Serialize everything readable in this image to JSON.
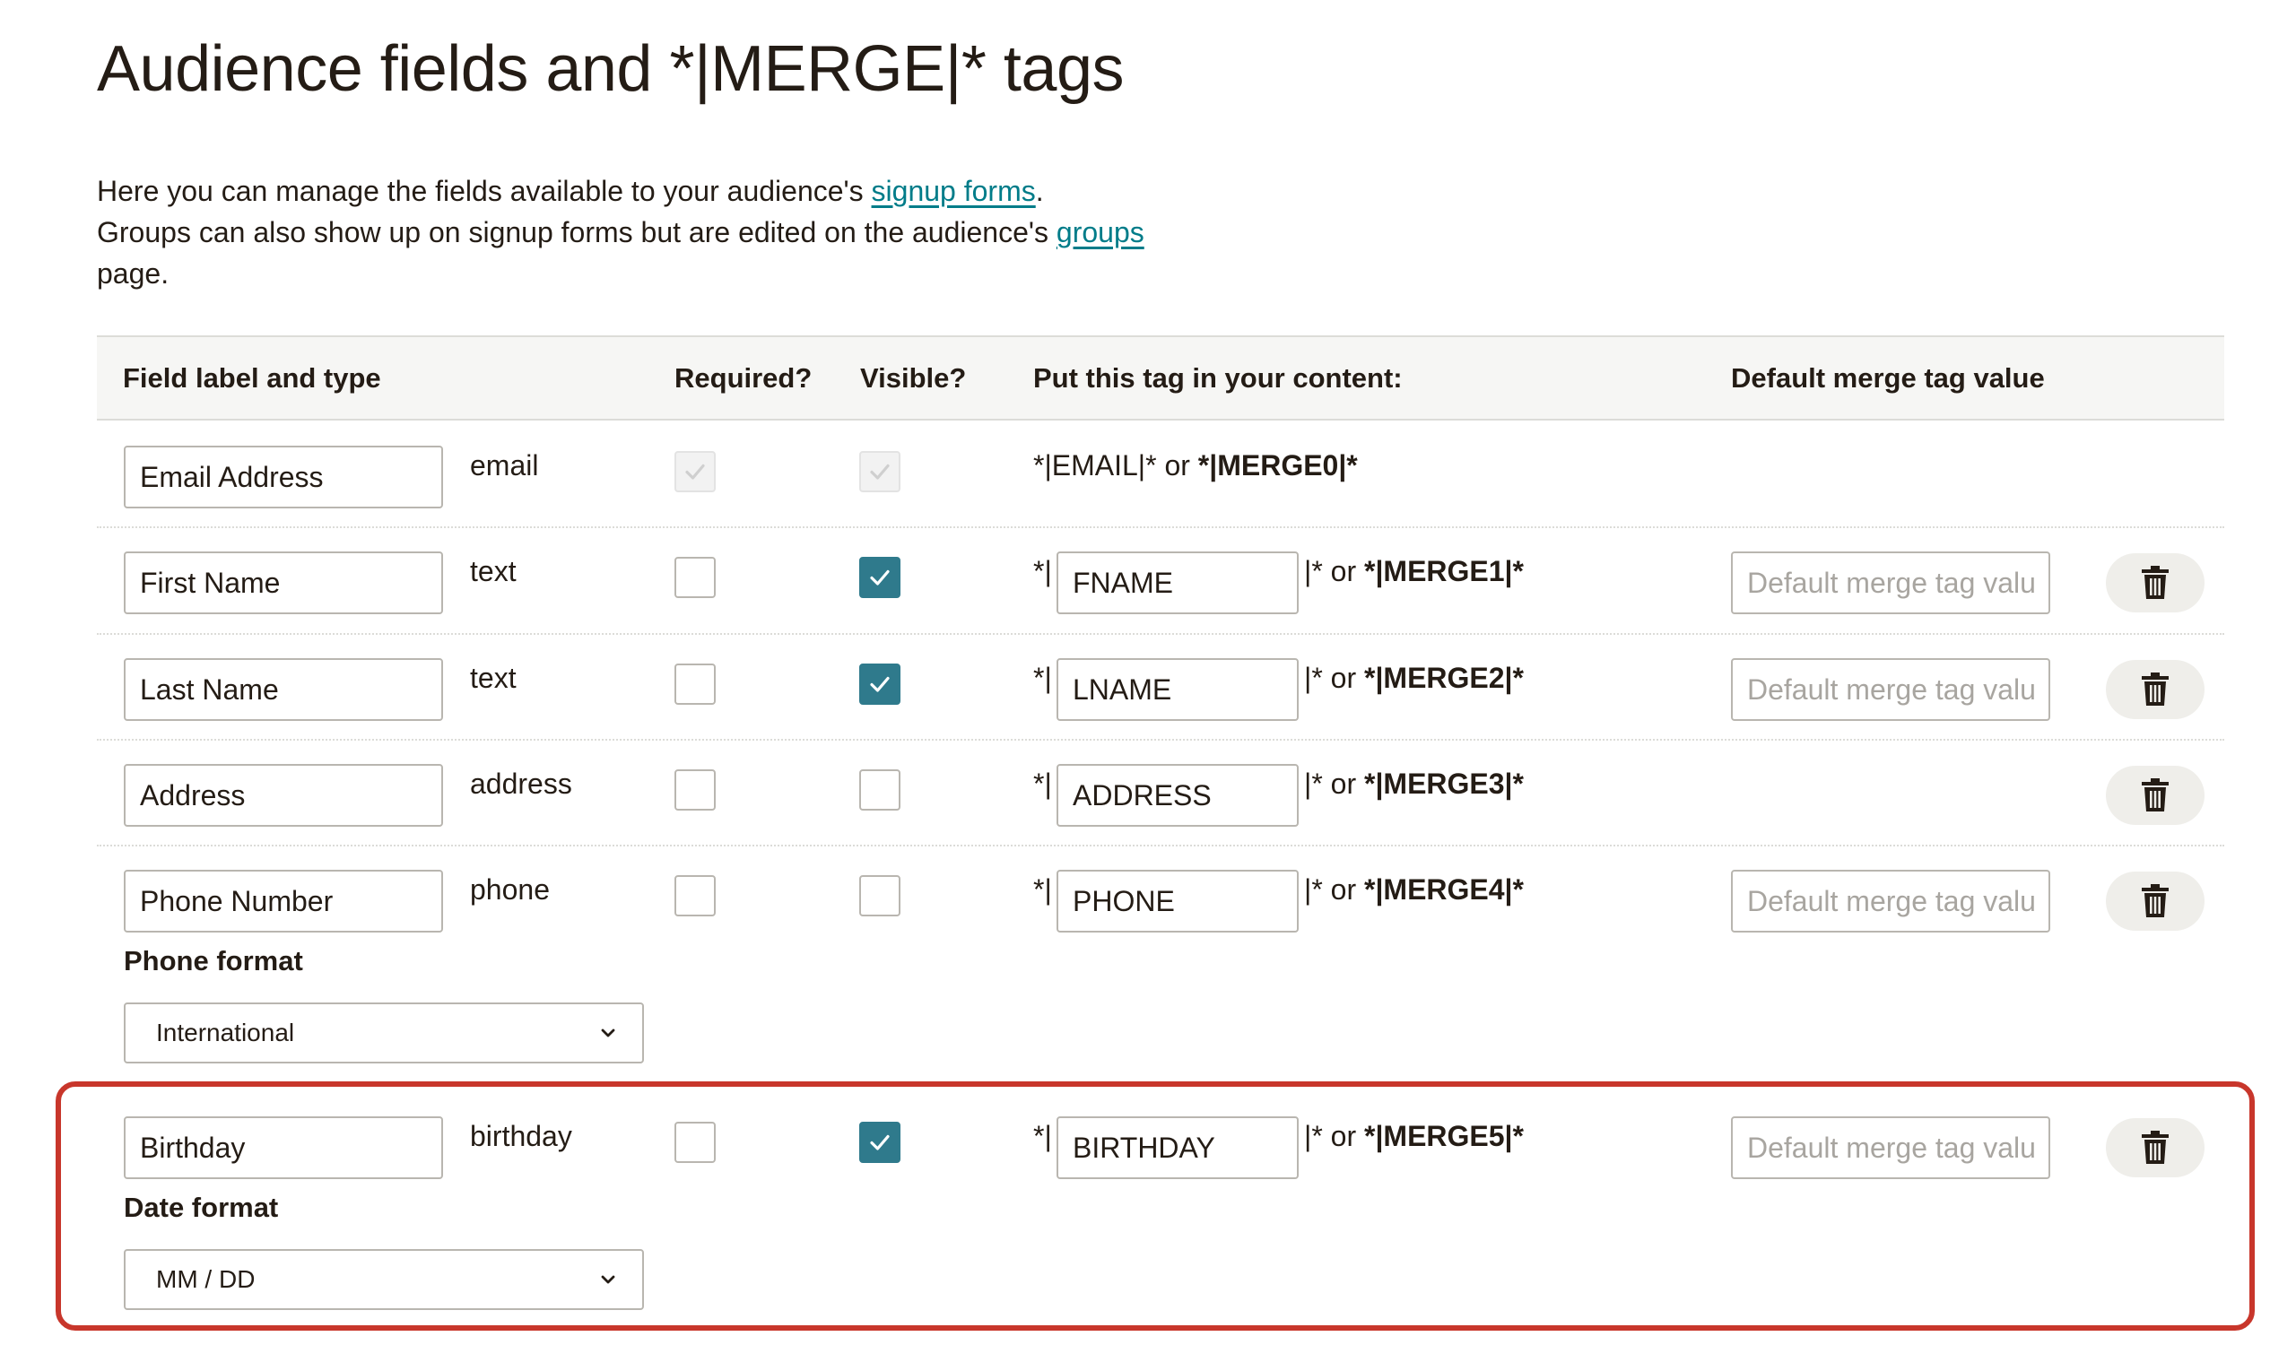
{
  "page_title": "Audience fields and *|MERGE|* tags",
  "intro": {
    "line1_prefix": "Here you can manage the fields available to your audience's ",
    "line1_link": "signup forms",
    "line1_suffix": ".",
    "line2_prefix": "Groups can also show up on signup forms but are edited on the audience's ",
    "line2_link": "groups",
    "line3": "page."
  },
  "columns": {
    "field": "Field label and type",
    "required": "Required?",
    "visible": "Visible?",
    "tag": "Put this tag in your content:",
    "default": "Default merge tag value"
  },
  "merge_tag": {
    "prefix": "*|",
    "suffix_mid": "|* or ",
    "default_placeholder": "Default merge tag valu"
  },
  "rows": [
    {
      "label": "Email Address",
      "type": "email",
      "required": true,
      "visible": true,
      "locked": true,
      "tag_text": "*|EMAIL|* or ",
      "merge": "*|MERGE0|*"
    },
    {
      "label": "First Name",
      "type": "text",
      "required": false,
      "visible": true,
      "tag": "FNAME",
      "merge": "*|MERGE1|*"
    },
    {
      "label": "Last Name",
      "type": "text",
      "required": false,
      "visible": true,
      "tag": "LNAME",
      "merge": "*|MERGE2|*"
    },
    {
      "label": "Address",
      "type": "address",
      "required": false,
      "visible": false,
      "tag": "ADDRESS",
      "merge": "*|MERGE3|*"
    },
    {
      "label": "Phone Number",
      "type": "phone",
      "required": false,
      "visible": false,
      "tag": "PHONE",
      "merge": "*|MERGE4|*",
      "sub_label": "Phone format",
      "sub_value": "International"
    },
    {
      "label": "Birthday",
      "type": "birthday",
      "required": false,
      "visible": true,
      "tag": "BIRTHDAY",
      "merge": "*|MERGE5|*",
      "sub_label": "Date format",
      "sub_value": "MM / DD"
    }
  ],
  "colors": {
    "accent": "#2f7a8c",
    "link": "#007c89",
    "highlight": "#c8362b",
    "header_bg": "#f6f6f4"
  },
  "icons": {
    "check": "checkmark-icon",
    "delete": "trash-icon",
    "dropdown": "chevron-down-icon"
  }
}
